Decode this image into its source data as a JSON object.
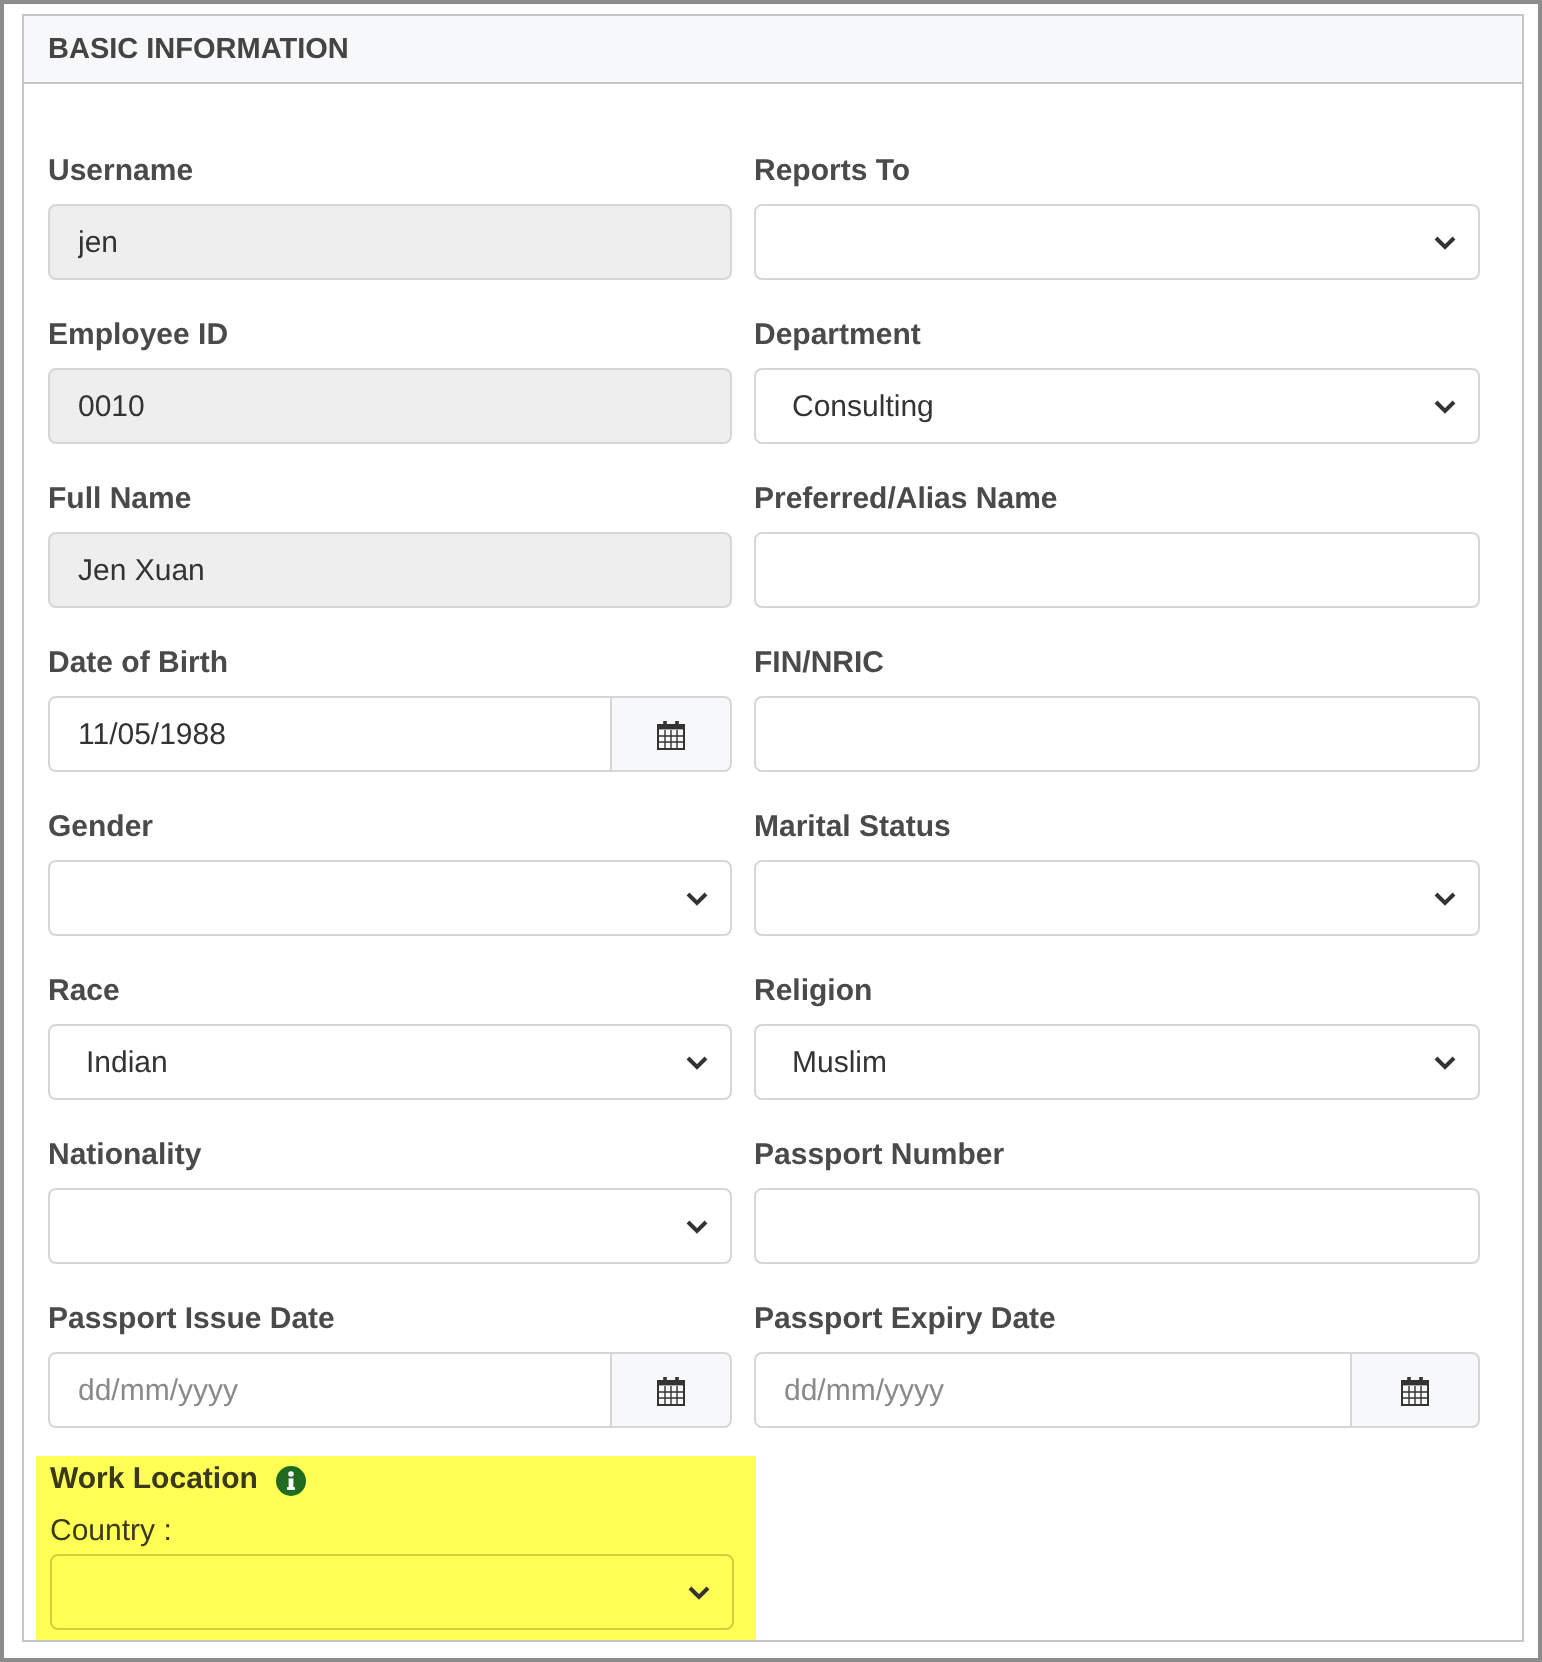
{
  "section": {
    "title": "BASIC INFORMATION"
  },
  "fields": [
    {
      "label": "Username",
      "kind": "text",
      "value": "jen",
      "disabled": true
    },
    {
      "label": "Reports To",
      "kind": "select",
      "disabled": false
    },
    {
      "label": "Employee ID",
      "kind": "text",
      "value": "0010",
      "disabled": true
    },
    {
      "label": "Department",
      "kind": "select",
      "value": "Consulting",
      "disabled": false
    },
    {
      "label": "Full Name",
      "kind": "text",
      "value": "Jen Xuan",
      "disabled": true
    },
    {
      "label": "Preferred/Alias Name",
      "kind": "text",
      "disabled": false
    },
    {
      "label": "Date of Birth",
      "kind": "date",
      "value": "11/05/1988",
      "disabled": false
    },
    {
      "label": "FIN/NRIC",
      "kind": "text",
      "disabled": false
    },
    {
      "label": "Gender",
      "kind": "select",
      "disabled": false
    },
    {
      "label": "Marital Status",
      "kind": "select",
      "disabled": false
    },
    {
      "label": "Race",
      "kind": "select",
      "value": "Indian",
      "disabled": false
    },
    {
      "label": "Religion",
      "kind": "select",
      "value": "Muslim",
      "disabled": false
    },
    {
      "label": "Nationality",
      "kind": "select",
      "disabled": false
    },
    {
      "label": "Passport Number",
      "kind": "text",
      "disabled": false
    },
    {
      "label": "Passport Issue Date",
      "kind": "date",
      "placeholder": "dd/mm/yyyy",
      "disabled": false
    },
    {
      "label": "Passport Expiry Date",
      "kind": "date",
      "placeholder": "dd/mm/yyyy",
      "disabled": false
    }
  ],
  "work_location": {
    "title": "Work Location",
    "highlighted": true,
    "country": {
      "label": "Country :",
      "kind": "select",
      "disabled": false
    }
  }
}
